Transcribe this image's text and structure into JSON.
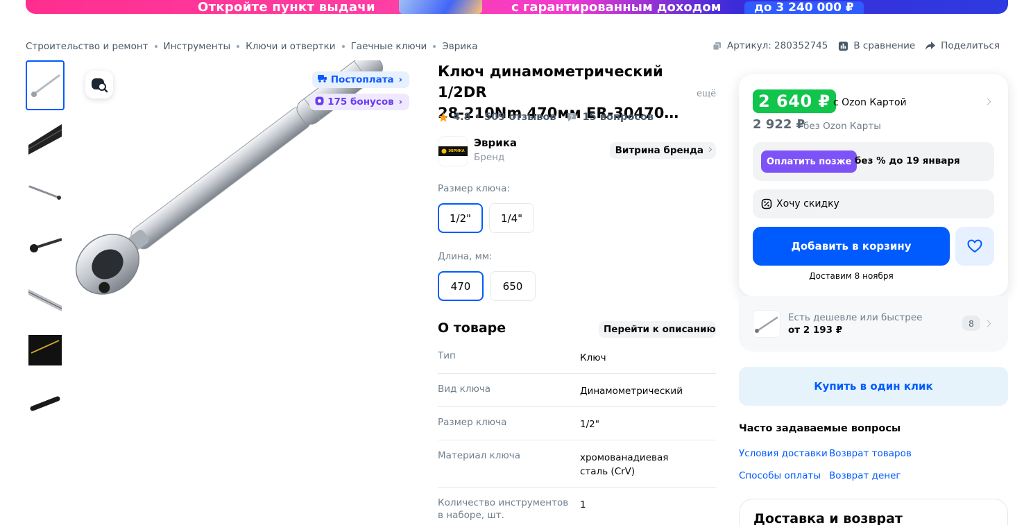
{
  "banner": {
    "left_text": "Откройте пункт выдачи",
    "right_text": "с гарантированным доходом",
    "pill": "до 3 240 000 ₽"
  },
  "breadcrumbs": [
    "Строительство и ремонт",
    "Инструменты",
    "Ключи и отвертки",
    "Гаечные ключи",
    "Эврика"
  ],
  "meta": {
    "article": "Артикул: 280352745",
    "compare": "В сравнение",
    "share": "Поделиться"
  },
  "gallery": {
    "thumb_count": 7,
    "badges": {
      "postpay": "Постоплата",
      "bonus": "175 бонусов"
    }
  },
  "product": {
    "title_line1": "Ключ динамометрический 1/2DR",
    "title_line2": "28-210Nm 470мм ER-30470…",
    "more": "ещё",
    "rating": "4.8 • 509 отзывов",
    "questions": "15 вопросов",
    "brand_name": "Эврика",
    "brand_role": "Бренд",
    "brand_store": "Витрина бренда",
    "logo_text": "ЭВРИКА"
  },
  "options": {
    "size_label": "Размер ключа:",
    "sizes": [
      "1/2\"",
      "1/4\""
    ],
    "length_label": "Длина, мм:",
    "lengths": [
      "470",
      "650"
    ]
  },
  "about": {
    "heading": "О товаре",
    "goto": "Перейти к описанию",
    "specs": [
      {
        "k": "Тип",
        "v": "Ключ"
      },
      {
        "k": "Вид ключа",
        "v": "Динамометрический"
      },
      {
        "k": "Размер ключа",
        "v": "1/2\""
      },
      {
        "k": "Материал ключа",
        "v": "хромованадиевая сталь (CrV)"
      },
      {
        "k": "Количество инструментов в наборе, шт.",
        "v": "1"
      }
    ]
  },
  "buy": {
    "price": "2 640 ₽",
    "price_label": "с Ozon Картой",
    "old_price": "2 922 ₽",
    "old_label": "без Ozon Карты",
    "pay_later": "Оплатить позже",
    "pay_later_text": "без % до 19 января",
    "discount": "Хочу скидку",
    "add_to_cart": "Добавить в корзину",
    "delivery": "Доставим 8 ноября"
  },
  "cheaper": {
    "text": "Есть дешевле или быстрее",
    "from": "от 2 193 ₽",
    "count": "8"
  },
  "one_click": "Купить в один клик",
  "faq": {
    "heading": "Часто задаваемые вопросы",
    "links": [
      "Условия доставки",
      "Возврат товаров",
      "Способы оплаты",
      "Возврат денег"
    ]
  },
  "delivery_card": "Доставка и возврат",
  "colors": {
    "accent": "#005bff",
    "price_green": "#10c44c",
    "pay_later": "#7d53f7"
  }
}
